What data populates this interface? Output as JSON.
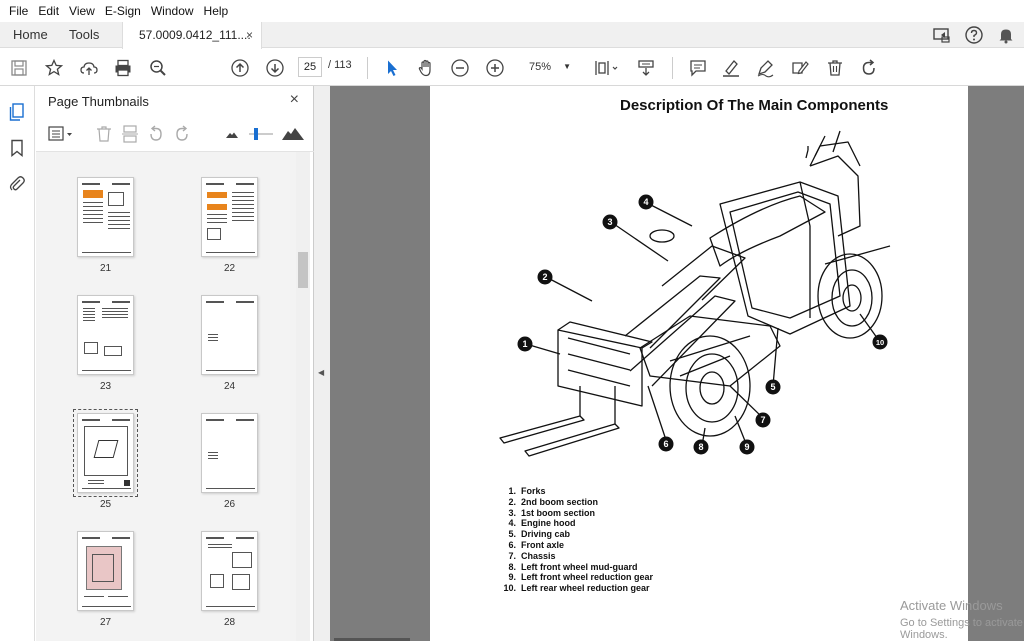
{
  "menu": [
    "File",
    "Edit",
    "View",
    "E-Sign",
    "Window",
    "Help"
  ],
  "tabs": {
    "home": "Home",
    "tools": "Tools",
    "document": "57.0009.0412_111....",
    "close": "×"
  },
  "toolbar": {
    "page_current": "25",
    "page_total": "/ 113",
    "zoom": "75%"
  },
  "panel": {
    "title": "Page Thumbnails",
    "close": "×",
    "thumbnails": [
      {
        "page": "21"
      },
      {
        "page": "22"
      },
      {
        "page": "23"
      },
      {
        "page": "24"
      },
      {
        "page": "25",
        "selected": true
      },
      {
        "page": "26"
      },
      {
        "page": "27"
      },
      {
        "page": "28"
      }
    ]
  },
  "document": {
    "title": "Description Of The Main Components",
    "callouts": [
      "1",
      "2",
      "3",
      "4",
      "5",
      "6",
      "7",
      "8",
      "9",
      "10"
    ],
    "parts": [
      {
        "n": "1.",
        "label": "Forks"
      },
      {
        "n": "2.",
        "label": "2nd boom section"
      },
      {
        "n": "3.",
        "label": "1st boom section"
      },
      {
        "n": "4.",
        "label": "Engine hood"
      },
      {
        "n": "5.",
        "label": "Driving cab"
      },
      {
        "n": "6.",
        "label": "Front axle"
      },
      {
        "n": "7.",
        "label": "Chassis"
      },
      {
        "n": "8.",
        "label": "Left front wheel mud-guard"
      },
      {
        "n": "9.",
        "label": "Left front wheel reduction gear"
      },
      {
        "n": "10.",
        "label": "Left rear wheel reduction gear"
      }
    ]
  },
  "watermark": {
    "line1": "Activate Windows",
    "line2": "Go to Settings to activate Windows."
  }
}
